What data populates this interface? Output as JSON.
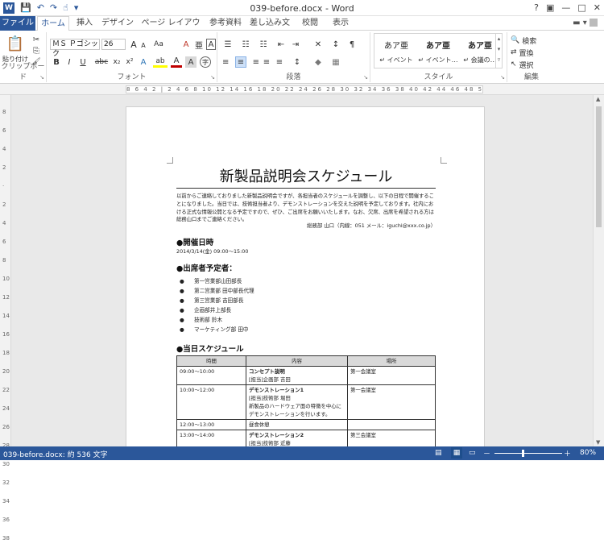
{
  "qat": {
    "save": "💾",
    "undo": "↶",
    "redo": "↷",
    "touch": "☝",
    "more": "▾"
  },
  "title": "039-before.docx - Word",
  "window": {
    "help": "?",
    "restore": "▣",
    "minimize": "—",
    "maximize": "□",
    "close": "✕"
  },
  "tabs": [
    "ファイル",
    "ホーム",
    "挿入",
    "デザイン",
    "ページ レイアウト",
    "参考資料",
    "差し込み文書",
    "校閲",
    "表示"
  ],
  "clipboard": {
    "paste": "貼り付け",
    "cut": "✂",
    "copy": "⎘",
    "painter": "🖌",
    "label": "クリップボード"
  },
  "font": {
    "name": "ＭＳ Ｐゴシック",
    "size": "26",
    "grow": "A",
    "shrink": "A",
    "case": "Aa",
    "clear": "A",
    "phonetic": "亜",
    "border": "A",
    "bold": "B",
    "italic": "I",
    "underline": "U",
    "strike": "abc",
    "sub": "x₂",
    "sup": "x²",
    "effects": "A",
    "highlight": "ab",
    "color": "A",
    "shade": "A",
    "circle": "字",
    "label": "フォント"
  },
  "paragraph": {
    "bullets": "☰",
    "numbering": "☷",
    "multilevel": "☷",
    "decrease": "⇤",
    "increase": "⇥",
    "asian": "✕",
    "sort": "↕",
    "marks": "¶",
    "left": "≡",
    "center": "≡",
    "right": "≡",
    "justify": "≡",
    "distributed": "≡",
    "spacing": "↕",
    "shading": "◆",
    "borders": "▦",
    "label": "段落"
  },
  "styles": {
    "items": [
      {
        "preview": "あア亜",
        "name": "↵ イベント"
      },
      {
        "preview": "あア亜",
        "name": "↵ イベント…"
      },
      {
        "preview": "あア亜",
        "name": "↵ 会議の…"
      }
    ],
    "label": "スタイル"
  },
  "editing": {
    "find": "検索",
    "replace": "置換",
    "select": "選択",
    "label": "編集"
  },
  "ruler": {
    "marks": "8 6 4 2 | 2 4 6 8 10 12 14 16 18 20 22 24 26 28 30 32 34 36 38 40 42 44 46 48 50 52 54 56"
  },
  "vruler": [
    "8",
    "6",
    "4",
    "2",
    "",
    "2",
    "4",
    "6",
    "8",
    "10",
    "12",
    "14",
    "16",
    "18",
    "20",
    "22",
    "24",
    "26",
    "28",
    "30",
    "32",
    "34",
    "36",
    "38"
  ],
  "document": {
    "title": "新製品説明会スケジュール",
    "intro": "以前からご連絡しておりました新製品説明会ですが、各担当者のスケジュールを調整し、以下の日程で開催することになりました。当日では、技術担当者より、デモンストレーションを交えた説明を予定しております。社内における正式な情報公開となる予定ですので、ぜひ、ご出席をお願いいたします。なお、欠席、出席を希望される方は総務山口までご連絡ください。",
    "contact": "総務部 山口（内線：051 メール：iguchi@xxx.co.jp）",
    "h_date": "●開催日時",
    "date": "2014/3/14(金) 09:00～15:00",
    "h_attendees": "●出席者予定者：",
    "attendees": [
      "第一営業部山田部長",
      "第二営業部 田中部長代理",
      "第三営業部 吉田部長",
      "企画部井上部長",
      "技術部 鈴木",
      "マーケティング部 田中"
    ],
    "h_schedule": "●当日スケジュール",
    "table": {
      "headers": [
        "時間",
        "内容",
        "場所"
      ],
      "rows": [
        {
          "time": "09:00～10:00",
          "content": [
            "コンセプト説明",
            "[担当]企画部 吉田"
          ],
          "place": "第一会議室"
        },
        {
          "time": "10:00～12:00",
          "content": [
            "デモンストレーション1",
            "[担当]技術部 堀田",
            "新製品のハードウェア面の特徴を中心にデモンストレーションを行います。"
          ],
          "place": "第一会議室"
        },
        {
          "time": "12:00～13:00",
          "content": [
            "昼食休憩"
          ],
          "place": ""
        },
        {
          "time": "13:00～14:00",
          "content": [
            "デモンストレーション2",
            "[担当]技術部 近藤"
          ],
          "place": "第三会議室"
        }
      ]
    }
  },
  "status": {
    "page": "039-before.docx: 約 536 文字",
    "zoom": "80%",
    "minus": "－",
    "plus": "＋"
  }
}
